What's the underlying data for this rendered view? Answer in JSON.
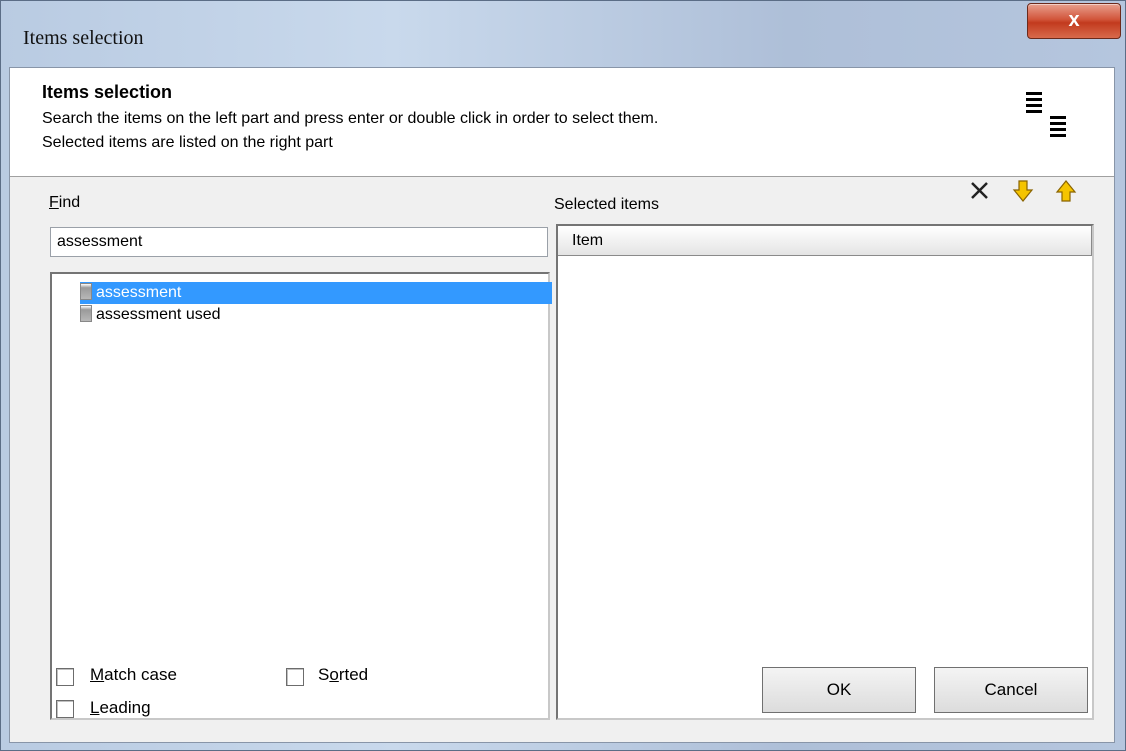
{
  "window": {
    "title": "Items selection",
    "close_glyph": "x"
  },
  "header": {
    "title": "Items selection",
    "line1": "Search the items on the left part and press enter or double click in order to select them.",
    "line2": "Selected items are listed on the right part",
    "icon": "list-columns-icon"
  },
  "find": {
    "label_ul": "F",
    "label_rest": "ind",
    "value": "assessment",
    "results": [
      {
        "label": "assessment",
        "selected": true
      },
      {
        "label": "assessment used",
        "selected": false
      }
    ]
  },
  "selected": {
    "label": "Selected items",
    "column_header": "Item",
    "tools": [
      "delete-icon",
      "move-down-icon",
      "move-up-icon"
    ],
    "accent_color": "#e8b000"
  },
  "options": {
    "match_case": {
      "ul": "M",
      "rest": "atch case",
      "checked": false
    },
    "leading": {
      "ul": "L",
      "rest": "eading",
      "checked": false
    },
    "sorted": {
      "pre": "S",
      "ul": "o",
      "rest": "rted",
      "checked": false
    }
  },
  "buttons": {
    "ok": "OK",
    "cancel": "Cancel"
  },
  "colors": {
    "selection": "#3399ff",
    "close_button": "#c23a1e"
  }
}
